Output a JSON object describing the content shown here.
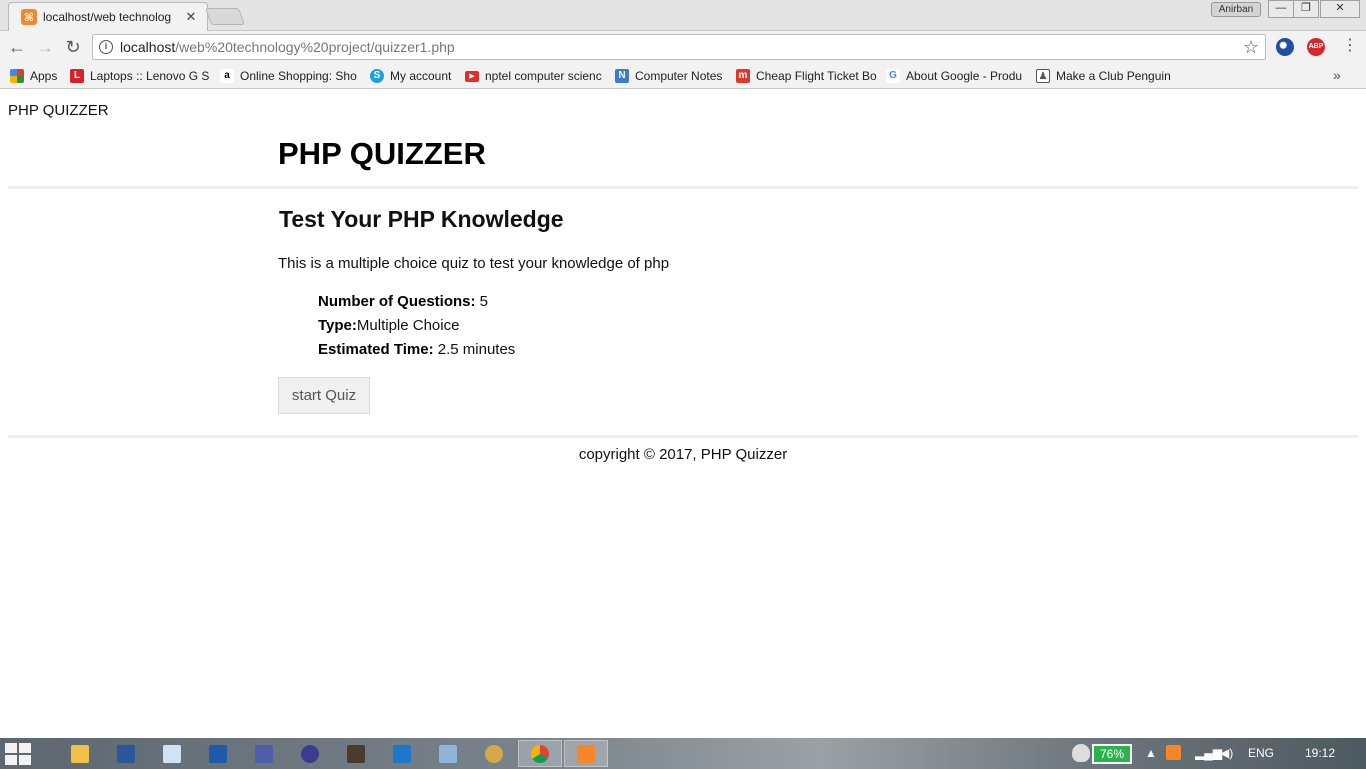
{
  "browser": {
    "tab_title": "localhost/web technolog",
    "tab_close": "✕",
    "user_name": "Anirban",
    "window_minimize": "—",
    "window_restore": "❐",
    "window_close": "✕",
    "url_host": "localhost",
    "url_path": "/web%20technology%20project/quizzer1.php",
    "back": "←",
    "forward": "→",
    "reload": "↻",
    "star": "☆",
    "menu": "⋮",
    "ext_abp": "ABP",
    "bookmarks_more": "»",
    "bookmarks": [
      {
        "label": "Apps",
        "icon": "apps-grid-icon",
        "color": "#e23b2f"
      },
      {
        "label": "Laptops :: Lenovo G S",
        "icon": "lenovo-l-icon",
        "color": "#d3242a"
      },
      {
        "label": "Online Shopping: Sho",
        "icon": "amazon-icon",
        "color": "#ffffff"
      },
      {
        "label": "My account",
        "icon": "skype-icon",
        "color": "#1aa1e1"
      },
      {
        "label": "nptel computer scienc",
        "icon": "youtube-icon",
        "color": "#e52d27"
      },
      {
        "label": "Computer Notes",
        "icon": "notes-icon",
        "color": "#3d7bd0"
      },
      {
        "label": "Cheap Flight Ticket Bo",
        "icon": "makemytrip-icon",
        "color": "#e0372b"
      },
      {
        "label": "About Google - Produ",
        "icon": "google-icon",
        "color": "#4285f4"
      },
      {
        "label": "Make a Club Penguin",
        "icon": "penguin-icon",
        "color": "#555555"
      }
    ]
  },
  "page": {
    "brand": "PHP QUIZZER",
    "title": "PHP QUIZZER",
    "section_title": "Test Your PHP Knowledge",
    "intro": "This is a multiple choice quiz to test your knowledge of php",
    "facts": [
      {
        "label": "Number of Questions:",
        "value": " 5"
      },
      {
        "label": "Type:",
        "value": "Multiple Choice"
      },
      {
        "label": "Estimated Time:",
        "value": " 2.5 minutes"
      }
    ],
    "start_button": "start Quiz",
    "copyright": "copyright © 2017, PHP Quizzer"
  },
  "taskbar": {
    "battery": "76%",
    "language": "ENG",
    "time": "19:12"
  }
}
